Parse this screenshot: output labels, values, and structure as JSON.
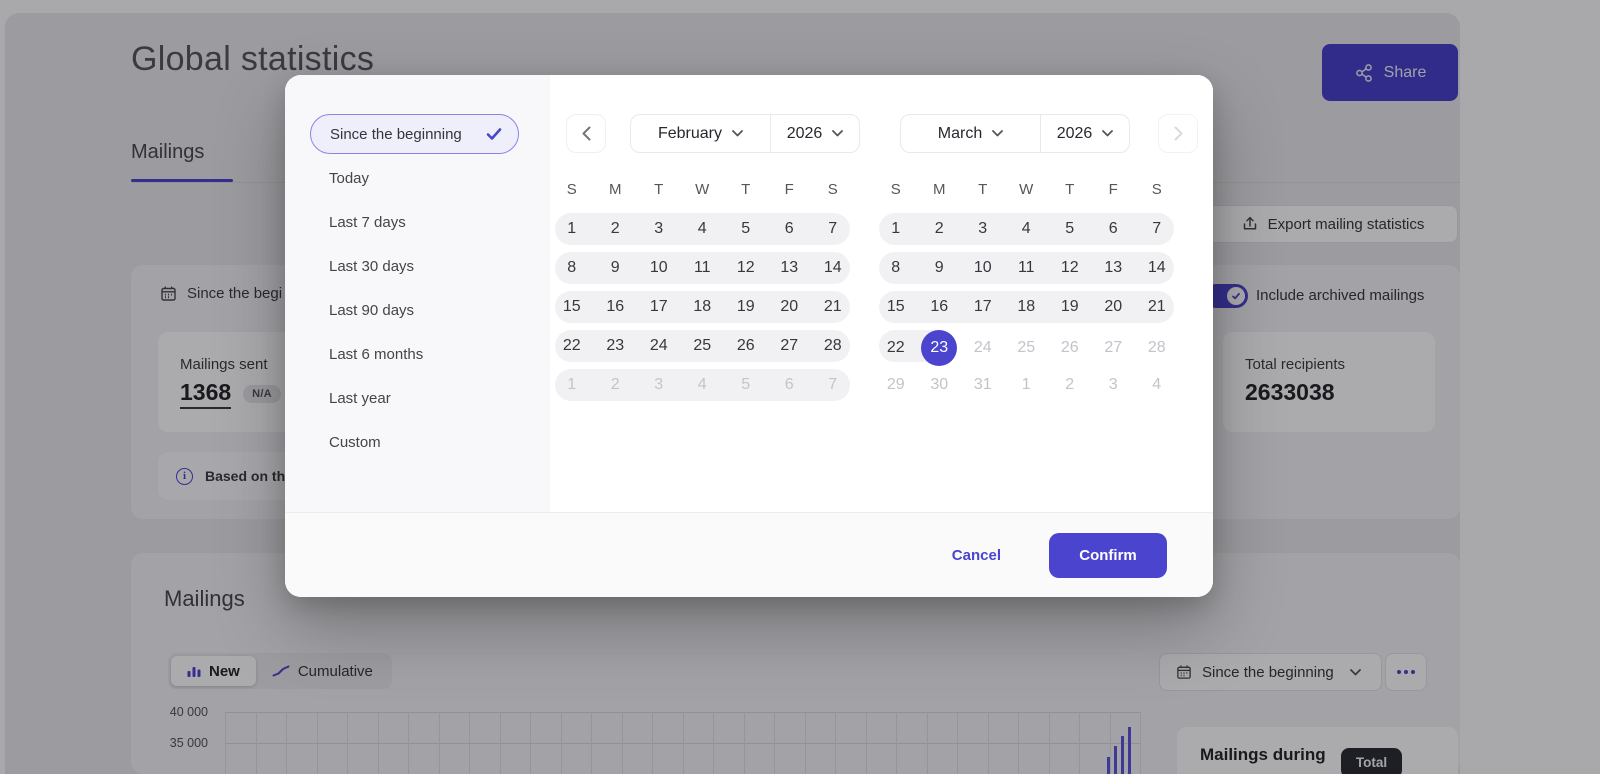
{
  "accent": "#4B44CF",
  "page": {
    "title": "Global statistics",
    "share": {
      "label": "Share"
    },
    "tabs": {
      "mailings": "Mailings"
    },
    "export_button": {
      "label": "Export mailing statistics"
    },
    "filter_bar": {
      "range_label": "Since the begi"
    },
    "archived_toggle": {
      "label": "Include archived mailings",
      "on": true
    },
    "stats": {
      "mailings_sent": {
        "label": "Mailings sent",
        "value": "1368",
        "badge": "N/A"
      },
      "total_recipients": {
        "label": "Total recipients",
        "value": "2633038"
      }
    },
    "info_note": {
      "text": "Based on the b"
    },
    "mailings_section": {
      "title": "Mailings",
      "view_toggle": {
        "new": "New",
        "cumulative": "Cumulative",
        "active": "New"
      },
      "range_dropdown": {
        "label": "Since the beginning"
      },
      "summary_card": {
        "title": "Mailings during",
        "badge": "Total"
      },
      "chart": {
        "type": "bar",
        "y_ticks": [
          {
            "label": "40 000",
            "value": 40000
          },
          {
            "label": "35 000",
            "value": 35000
          }
        ],
        "grid": true,
        "visible_bar_values": [
          32700,
          34500,
          36100,
          37600
        ]
      }
    }
  },
  "modal": {
    "presets": [
      "Since the beginning",
      "Today",
      "Last 7 days",
      "Last 30 days",
      "Last 90 days",
      "Last 6 months",
      "Last year",
      "Custom"
    ],
    "selected_preset": "Since the beginning",
    "calendars": [
      {
        "month": "February",
        "year": "2026",
        "dow": [
          "S",
          "M",
          "T",
          "W",
          "T",
          "F",
          "S"
        ],
        "rows": [
          {
            "pill": 7,
            "days": [
              "1",
              "2",
              "3",
              "4",
              "5",
              "6",
              "7"
            ]
          },
          {
            "pill": 7,
            "days": [
              "8",
              "9",
              "10",
              "11",
              "12",
              "13",
              "14"
            ]
          },
          {
            "pill": 7,
            "days": [
              "15",
              "16",
              "17",
              "18",
              "19",
              "20",
              "21"
            ]
          },
          {
            "pill": 7,
            "days": [
              "22",
              "23",
              "24",
              "25",
              "26",
              "27",
              "28"
            ]
          },
          {
            "pill": 7,
            "days": [
              "1",
              "2",
              "3",
              "4",
              "5",
              "6",
              "7"
            ],
            "states": [
              "m",
              "m",
              "m",
              "m",
              "m",
              "m",
              "m"
            ]
          }
        ]
      },
      {
        "month": "March",
        "year": "2026",
        "dow": [
          "S",
          "M",
          "T",
          "W",
          "T",
          "F",
          "S"
        ],
        "rows": [
          {
            "pill": 7,
            "days": [
              "1",
              "2",
              "3",
              "4",
              "5",
              "6",
              "7"
            ]
          },
          {
            "pill": 7,
            "days": [
              "8",
              "9",
              "10",
              "11",
              "12",
              "13",
              "14"
            ]
          },
          {
            "pill": 7,
            "days": [
              "15",
              "16",
              "17",
              "18",
              "19",
              "20",
              "21"
            ]
          },
          {
            "pill": 2,
            "days": [
              "22",
              "23",
              "24",
              "25",
              "26",
              "27",
              "28"
            ],
            "states": [
              "n",
              "s",
              "m",
              "m",
              "m",
              "m",
              "m"
            ]
          },
          {
            "pill": 0,
            "days": [
              "29",
              "30",
              "31",
              "1",
              "2",
              "3",
              "4"
            ],
            "states": [
              "m",
              "m",
              "m",
              "m",
              "m",
              "m",
              "m"
            ]
          }
        ]
      }
    ],
    "selected_day": "23",
    "footer": {
      "cancel": "Cancel",
      "confirm": "Confirm"
    }
  }
}
